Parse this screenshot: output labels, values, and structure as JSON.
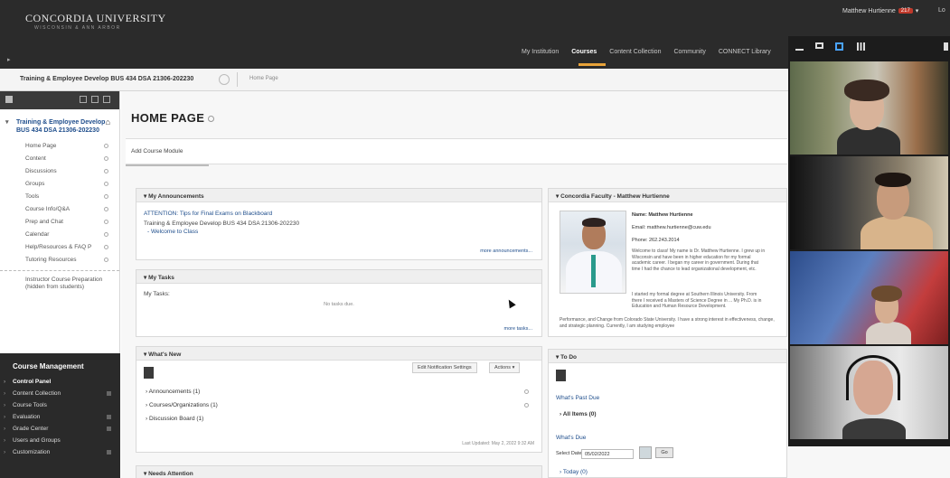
{
  "header": {
    "brand": "CONCORDIA UNIVERSITY",
    "brand_sub": "WISCONSIN & ANN ARBOR",
    "user_name": "Matthew Hurtienne",
    "user_badge": "217",
    "logout": "Lo",
    "nav_tabs": [
      "My Institution",
      "Courses",
      "Content Collection",
      "Community",
      "CONNECT Library"
    ],
    "active_tab": "Courses",
    "accent": "#e8a33a"
  },
  "breadcrumb": {
    "course": "Training & Employee Develop BUS 434 DSA 21306-202230",
    "page": "Home Page"
  },
  "sidebar": {
    "course_title": "Training & Employee Develop BUS 434 DSA 21306-202230",
    "items": [
      "Home Page",
      "Content",
      "Discussions",
      "Groups",
      "Tools",
      "Course Info/Q&A",
      "Prep and Chat",
      "Calendar",
      "Help/Resources & FAQ P",
      "Tutoring Resources"
    ],
    "extra_item": "Instructor Course Preparation (hidden from students)",
    "management_title": "Course Management",
    "management_items": [
      "Control Panel",
      "Content Collection",
      "Course Tools",
      "Evaluation",
      "Grade Center",
      "Users and Groups",
      "Customization"
    ]
  },
  "main": {
    "page_title": "HOME PAGE",
    "add_module": "Add Course Module",
    "announcements": {
      "title": "My Announcements",
      "link": "ATTENTION: Tips for Final Exams on Blackboard",
      "course_line": "Training & Employee Develop BUS 434 DSA 21306-202230",
      "welcome": "- Welcome to Class",
      "more": "more announcements..."
    },
    "tasks": {
      "title": "My Tasks",
      "label": "My Tasks:",
      "empty": "No tasks due.",
      "more": "more tasks..."
    },
    "whats_new": {
      "title": "What's New",
      "edit_btn": "Edit Notification Settings",
      "actions_btn": "Actions",
      "rows": [
        "Announcements (1)",
        "Courses/Organizations (1)",
        "Discussion Board (1)"
      ],
      "updated": "Last Updated: May 2, 2022 9:32 AM"
    },
    "needs_attention": {
      "title": "Needs Attention"
    },
    "faculty": {
      "title": "Concordia Faculty - Matthew Hurtienne",
      "name": "Name: Matthew Hurtienne",
      "email": "Email: matthew.hurtienne@cuw.edu",
      "phone": "Phone: 262.243.2014",
      "bio1": "Welcome to class! My name is Dr. Matthew Hurtienne. I grew up in Wisconsin and have been in higher education for my formal academic career. I began my career in government. During that time I had the chance to lead organizational development, etc.",
      "bio2": "I started my formal degree at Southern Illinois University. From there I received a Masters of Science Degree in ... My Ph.D. is in Education and Human Resource Development.",
      "bio3": "Performance, and Change from Colorado State University. I have a strong interest in effectiveness, change, and strategic planning. Currently, I am studying employee"
    },
    "todo": {
      "title": "To Do",
      "past_due": "What's Past Due",
      "all_items": "All Items (0)",
      "due": "What's Due",
      "select_date_label": "Select Date:",
      "select_date_value": "05/02/2022",
      "go": "Go",
      "today": "Today (0)"
    }
  },
  "video": {
    "tiles": [
      "participant-1",
      "participant-2",
      "participant-3",
      "participant-4"
    ],
    "active_color": "#4aa3ff"
  }
}
